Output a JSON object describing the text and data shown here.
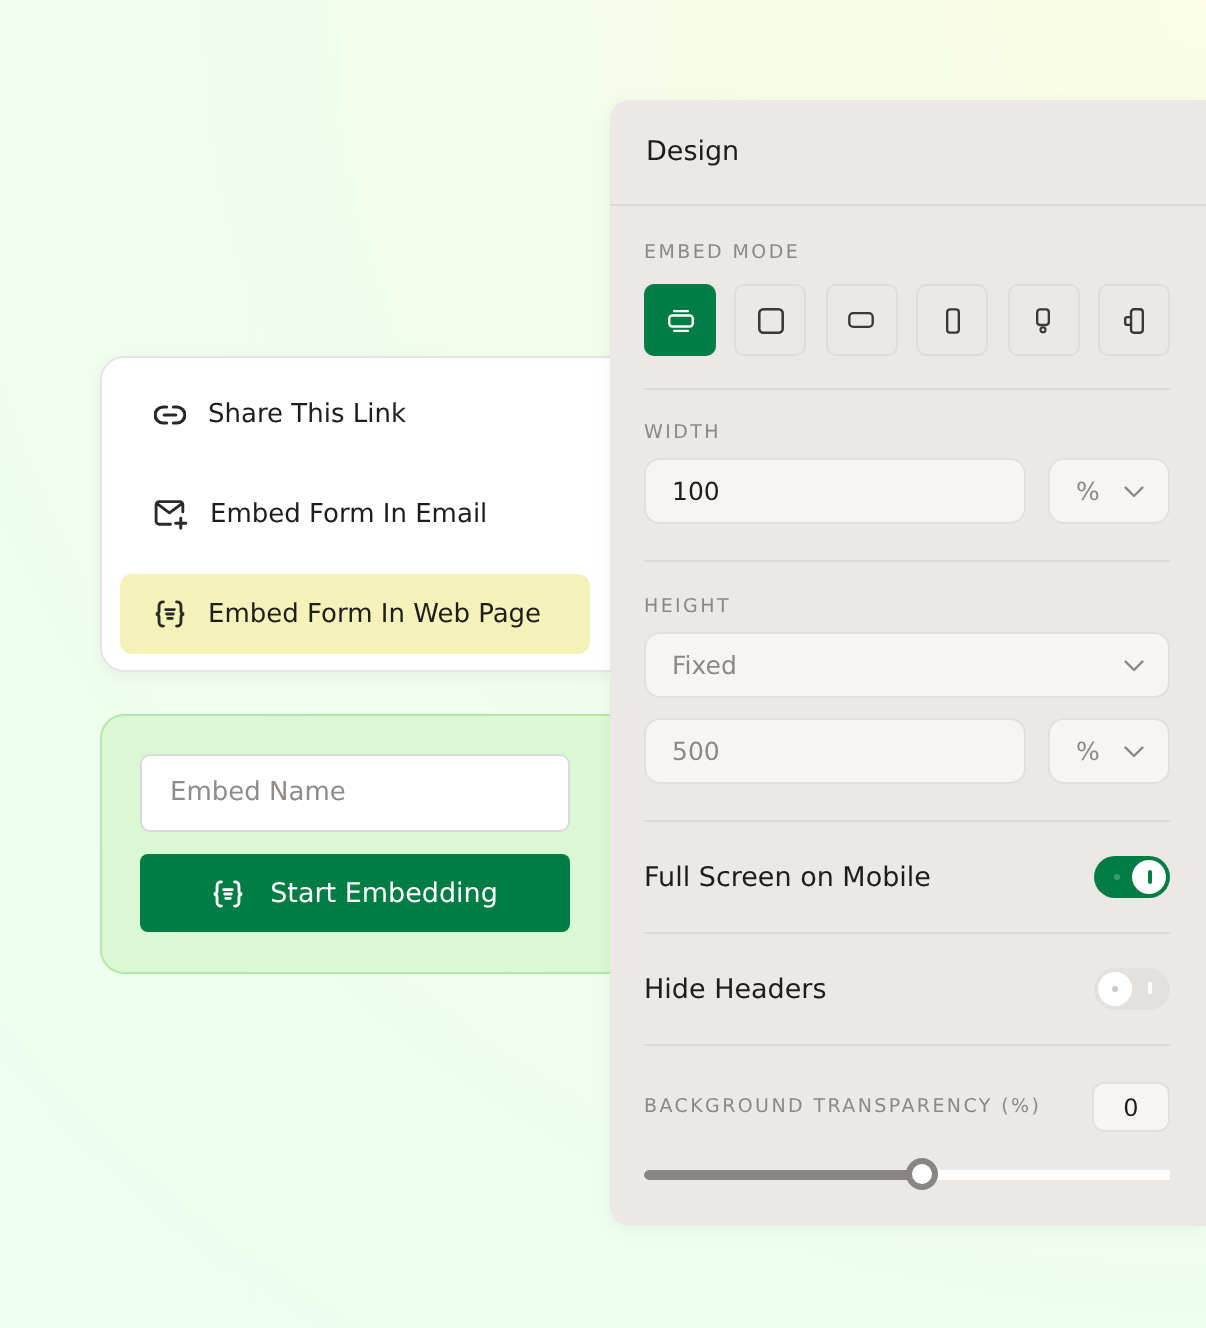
{
  "share_menu": {
    "items": [
      {
        "kind": "link",
        "label": "Share This Link",
        "selected": false
      },
      {
        "kind": "email",
        "label": "Embed Form In Email",
        "selected": false
      },
      {
        "kind": "webpage",
        "label": "Embed Form In Web Page",
        "selected": true
      }
    ]
  },
  "embed_form": {
    "name_field": {
      "placeholder": "Embed Name"
    },
    "button": {
      "label": "Start Embedding"
    }
  },
  "design": {
    "title": "Design",
    "embed_mode": {
      "label": "EMBED MODE",
      "options": [
        {
          "kind": "inline",
          "selected": true
        },
        {
          "kind": "fullpage",
          "selected": false
        },
        {
          "kind": "popup",
          "selected": false
        },
        {
          "kind": "slider",
          "selected": false
        },
        {
          "kind": "popover",
          "selected": false
        },
        {
          "kind": "sidetab",
          "selected": false
        }
      ]
    },
    "width": {
      "label": "WIDTH",
      "value": "100",
      "unit": "%"
    },
    "height": {
      "label": "HEIGHT",
      "mode": "Fixed",
      "placeholder": "500",
      "unit": "%"
    },
    "toggles": [
      {
        "label": "Full Screen on Mobile",
        "on": true
      },
      {
        "label": "Hide Headers",
        "on": false
      }
    ],
    "transparency": {
      "label": "BACKGROUND TRANSPARENCY (%)",
      "value": "0",
      "level": 0.53
    }
  }
}
